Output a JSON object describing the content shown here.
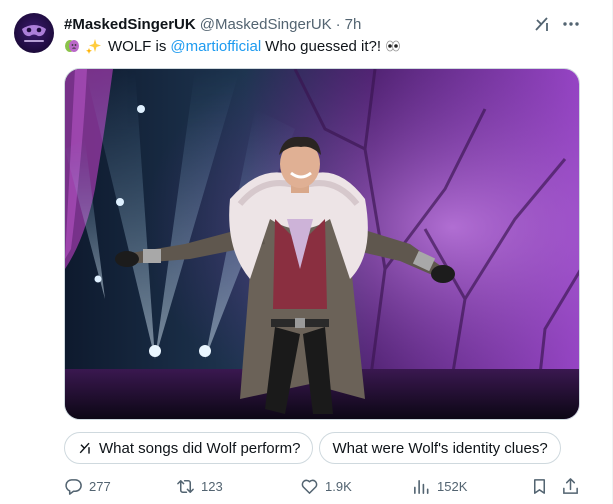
{
  "tweet": {
    "display_name": "#MaskedSingerUK",
    "handle": "@MaskedSingerUK",
    "separator": "·",
    "time": "7h",
    "text_before": "WOLF is",
    "mention": "@martiofficial",
    "text_after": "Who guessed it?!",
    "emojis": [
      "performing-arts-emoji",
      "sparkles-emoji",
      "eyes-emoji"
    ]
  },
  "grok_prompts": [
    "What songs did Wolf perform?",
    "What were Wolf's identity clues?"
  ],
  "metrics": {
    "replies": "277",
    "reposts": "123",
    "likes": "1.9K",
    "views": "152K"
  },
  "colors": {
    "accent": "#1d9bf0",
    "secondary_text": "#536471",
    "border": "#cfd9de",
    "stage_purple": "#8a3fc4",
    "stage_blue": "#3c7fb0"
  },
  "icons": [
    "grok-icon",
    "more-icon",
    "reply-icon",
    "repost-icon",
    "like-icon",
    "views-icon",
    "bookmark-icon",
    "share-icon"
  ]
}
